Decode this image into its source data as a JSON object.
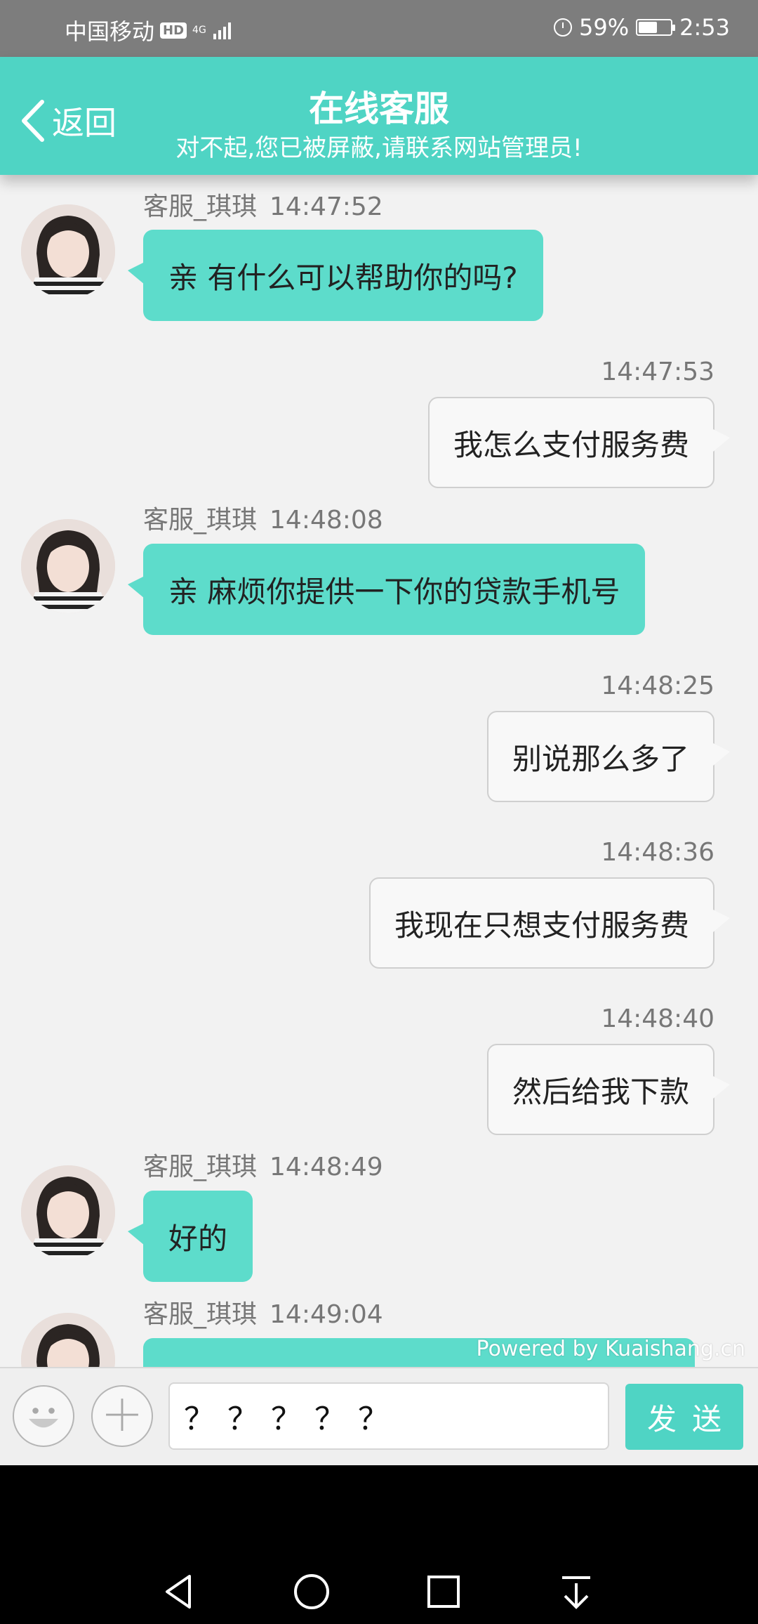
{
  "status_bar": {
    "carrier": "中国移动",
    "hd": "HD",
    "network": "4G",
    "network_sub": "46",
    "battery_percent": "59%",
    "battery_level": 0.59,
    "time": "2:53"
  },
  "header": {
    "back_label": "返回",
    "title": "在线客服",
    "subtitle": "对不起,您已被屏蔽,请联系网站管理员!"
  },
  "agent": {
    "name": "客服_琪琪"
  },
  "messages": [
    {
      "side": "left",
      "time": "14:47:52",
      "text": "亲 有什么可以帮助你的吗?"
    },
    {
      "side": "right",
      "time": "14:47:53",
      "text": "我怎么支付服务费"
    },
    {
      "side": "left",
      "time": "14:48:08",
      "text": "亲 麻烦你提供一下你的贷款手机号"
    },
    {
      "side": "right",
      "time": "14:48:25",
      "text": "别说那么多了"
    },
    {
      "side": "right",
      "time": "14:48:36",
      "text": "我现在只想支付服务费"
    },
    {
      "side": "right",
      "time": "14:48:40",
      "text": "然后给我下款"
    },
    {
      "side": "left",
      "time": "14:48:49",
      "text": "好的"
    },
    {
      "side": "left",
      "time": "14:49:04",
      "text": ""
    }
  ],
  "powered_by": "Powered by Kuaishang.cn",
  "input": {
    "value": "？？？？？",
    "send_label": "发送"
  },
  "icons": {
    "emoji": "emoji-icon",
    "plus": "plus-icon",
    "back": "chevron-left-icon",
    "nav_back": "triangle-back-icon",
    "nav_home": "circle-home-icon",
    "nav_recent": "square-recent-icon",
    "nav_notify": "pull-down-icon"
  },
  "colors": {
    "accent": "#4fd4c4",
    "agent_bubble": "#5ddccb",
    "user_bubble": "#f8f8f8"
  }
}
